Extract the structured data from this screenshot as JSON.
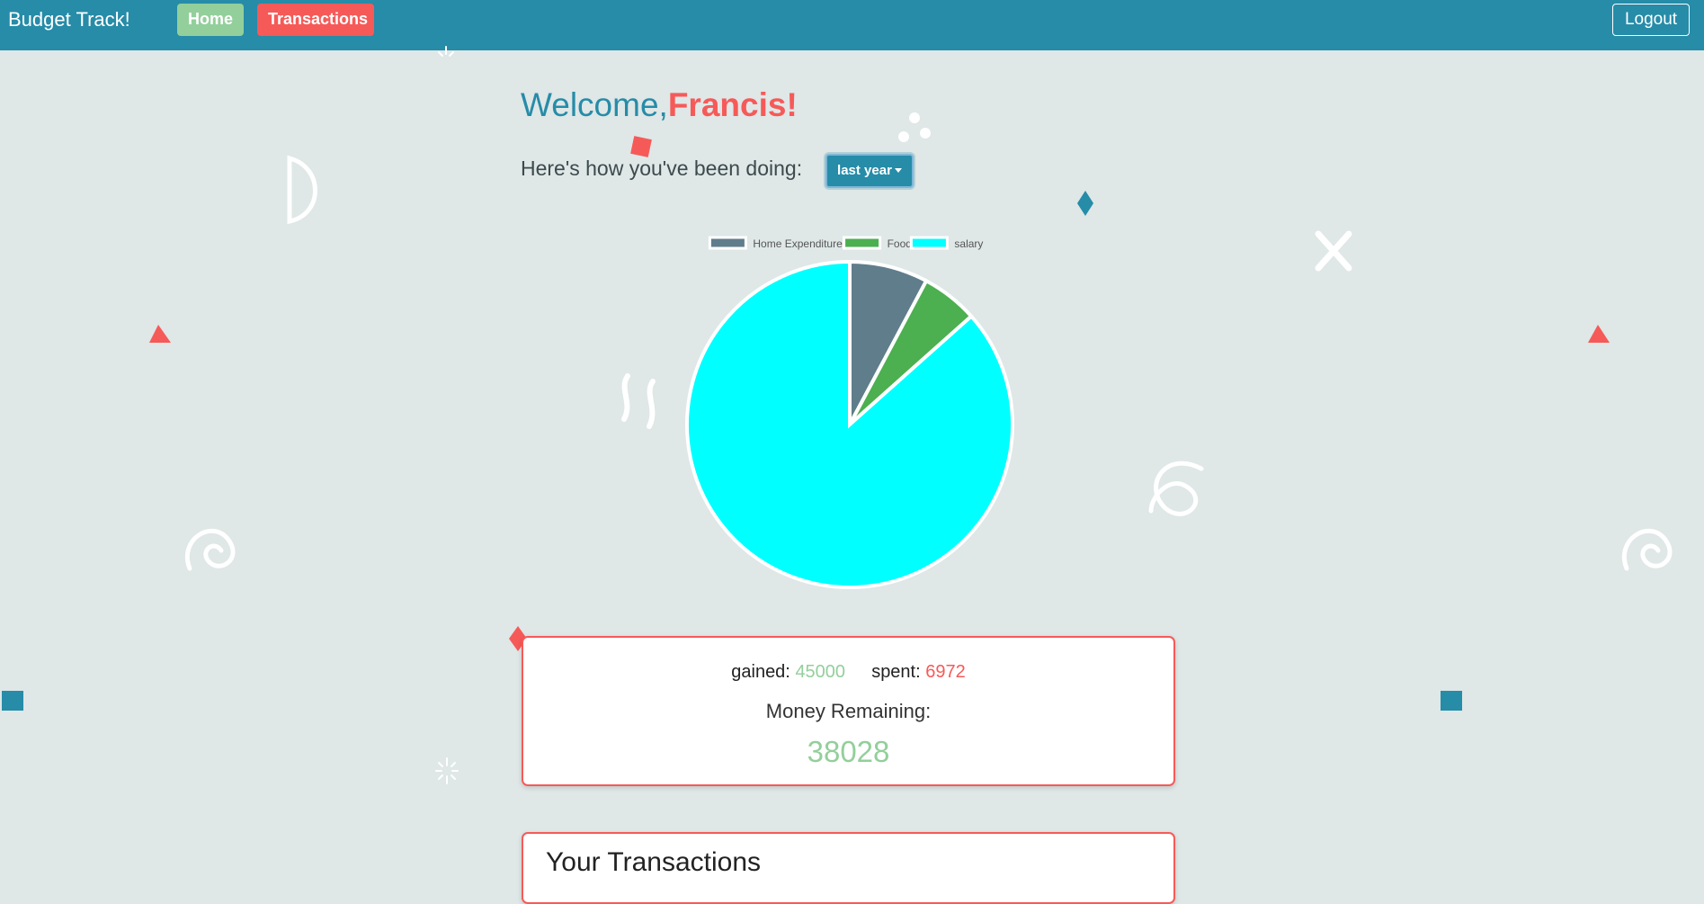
{
  "navbar": {
    "brand": "Budget Track!",
    "home_label": "Home",
    "transactions_label": "Transactions",
    "logout_label": "Logout"
  },
  "welcome": {
    "prefix": "Welcome,",
    "name": "Francis",
    "suffix": "!"
  },
  "period": {
    "prompt": "Here's how you've been doing:",
    "selected": "last year"
  },
  "summary": {
    "gained_label": "gained:",
    "gained_value": "45000",
    "spent_label": "spent:",
    "spent_value": "6972",
    "remaining_label": "Money Remaining:",
    "remaining_value": "38028"
  },
  "transactions": {
    "title": "Your Transactions"
  },
  "colors": {
    "primary": "#268ca8",
    "accent": "#f65a58",
    "positive": "#93cf9b",
    "background": "#dfe7e7"
  },
  "chart_data": {
    "type": "pie",
    "title": "",
    "legend_position": "top",
    "series": [
      {
        "name": "Home Expenditure",
        "value": 4050,
        "color": "#607d8b"
      },
      {
        "name": "Food",
        "value": 2922,
        "color": "#4caf50"
      },
      {
        "name": "salary",
        "value": 45000,
        "color": "#00ffff"
      }
    ]
  }
}
